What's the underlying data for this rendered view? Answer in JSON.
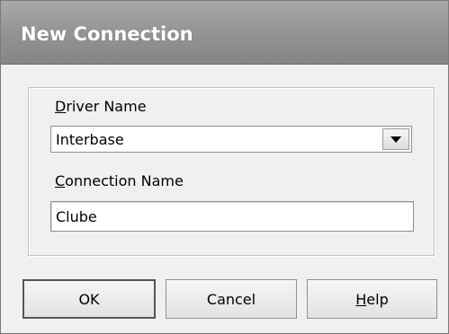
{
  "window": {
    "title": "New Connection"
  },
  "form": {
    "driver_label_prefix": "D",
    "driver_label_rest": "river Name",
    "driver_value": "Interbase",
    "connection_label_prefix": "C",
    "connection_label_rest": "onnection Name",
    "connection_value": "Clube"
  },
  "buttons": {
    "ok": "OK",
    "cancel": "Cancel",
    "help_prefix": "H",
    "help_rest": "elp"
  },
  "icons": {
    "dropdown": "chevron-down-icon"
  }
}
